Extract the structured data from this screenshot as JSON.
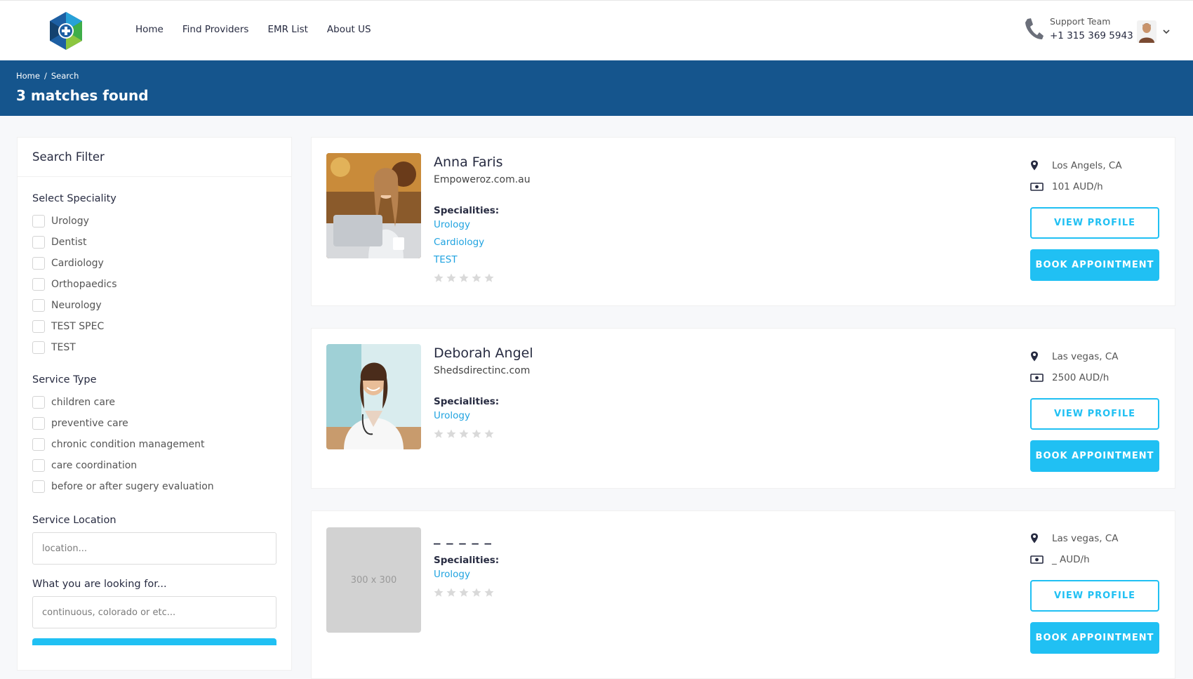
{
  "nav": {
    "items": [
      {
        "label": "Home"
      },
      {
        "label": "Find Providers"
      },
      {
        "label": "EMR List"
      },
      {
        "label": "About US"
      }
    ]
  },
  "support": {
    "label": "Support Team",
    "phone": "+1 315 369 5943"
  },
  "breadcrumb": {
    "home": "Home",
    "separator": "/",
    "current": "Search"
  },
  "page_title": "3 matches found",
  "filter": {
    "title": "Search Filter",
    "speciality_title": "Select Speciality",
    "specialities": [
      "Urology",
      "Dentist",
      "Cardiology",
      "Orthopaedics",
      "Neurology",
      "TEST SPEC",
      "TEST"
    ],
    "service_type_title": "Service Type",
    "service_types": [
      "children care",
      "preventive care",
      "chronic condition management",
      "care coordination",
      "before or after sugery evaluation"
    ],
    "location_title": "Service Location",
    "location_placeholder": "location...",
    "looking_title": "What you are looking for...",
    "looking_placeholder": "continuous, colorado or etc..."
  },
  "providers": [
    {
      "name": "Anna Faris",
      "website": "Empoweroz.com.au",
      "specialities_label": "Specialities:",
      "specialities": [
        "Urology",
        "Cardiology",
        "TEST"
      ],
      "rating": 0,
      "location": "Los Angels, CA",
      "rate": "101 AUD/h",
      "view_label": "VIEW PROFILE",
      "book_label": "BOOK APPOINTMENT"
    },
    {
      "name": "Deborah Angel",
      "website": "Shedsdirectinc.com",
      "specialities_label": "Specialities:",
      "specialities": [
        "Urology"
      ],
      "rating": 0,
      "location": "Las vegas, CA",
      "rate": "2500 AUD/h",
      "view_label": "VIEW PROFILE",
      "book_label": "BOOK APPOINTMENT"
    },
    {
      "name": "_ _ _ _ _",
      "website": "",
      "photo_placeholder": "300 x 300",
      "specialities_label": "Specialities:",
      "specialities": [
        "Urology"
      ],
      "rating": 0,
      "location": "Las vegas, CA",
      "rate": "_ AUD/h",
      "view_label": "VIEW PROFILE",
      "book_label": "BOOK APPOINTMENT"
    }
  ],
  "colors": {
    "header_blue": "#15558d",
    "accent": "#20c0f3",
    "link": "#20a3e0"
  }
}
